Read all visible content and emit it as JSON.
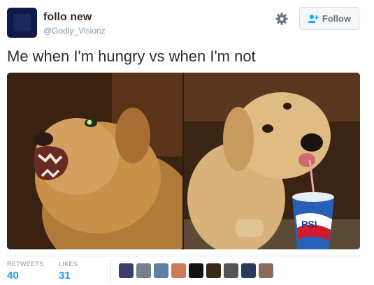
{
  "tweet": {
    "display_name": "follo new",
    "handle": "@Godly_Visionz",
    "text": "Me when I'm hungry vs when I'm not",
    "follow_label": "Follow"
  },
  "stats": {
    "retweets_label": "RETWEETS",
    "retweets_count": "40",
    "likes_label": "LIKES",
    "likes_count": "31"
  },
  "liker_colors": [
    "#3b3f6e",
    "#7a7f8c",
    "#5d7fa3",
    "#d07a5a",
    "#111111",
    "#3a2818",
    "#555555",
    "#2a3a5a",
    "#8a6a5a"
  ],
  "colors": {
    "accent": "#1da1f2",
    "text": "#292f33",
    "muted": "#8899a6"
  }
}
